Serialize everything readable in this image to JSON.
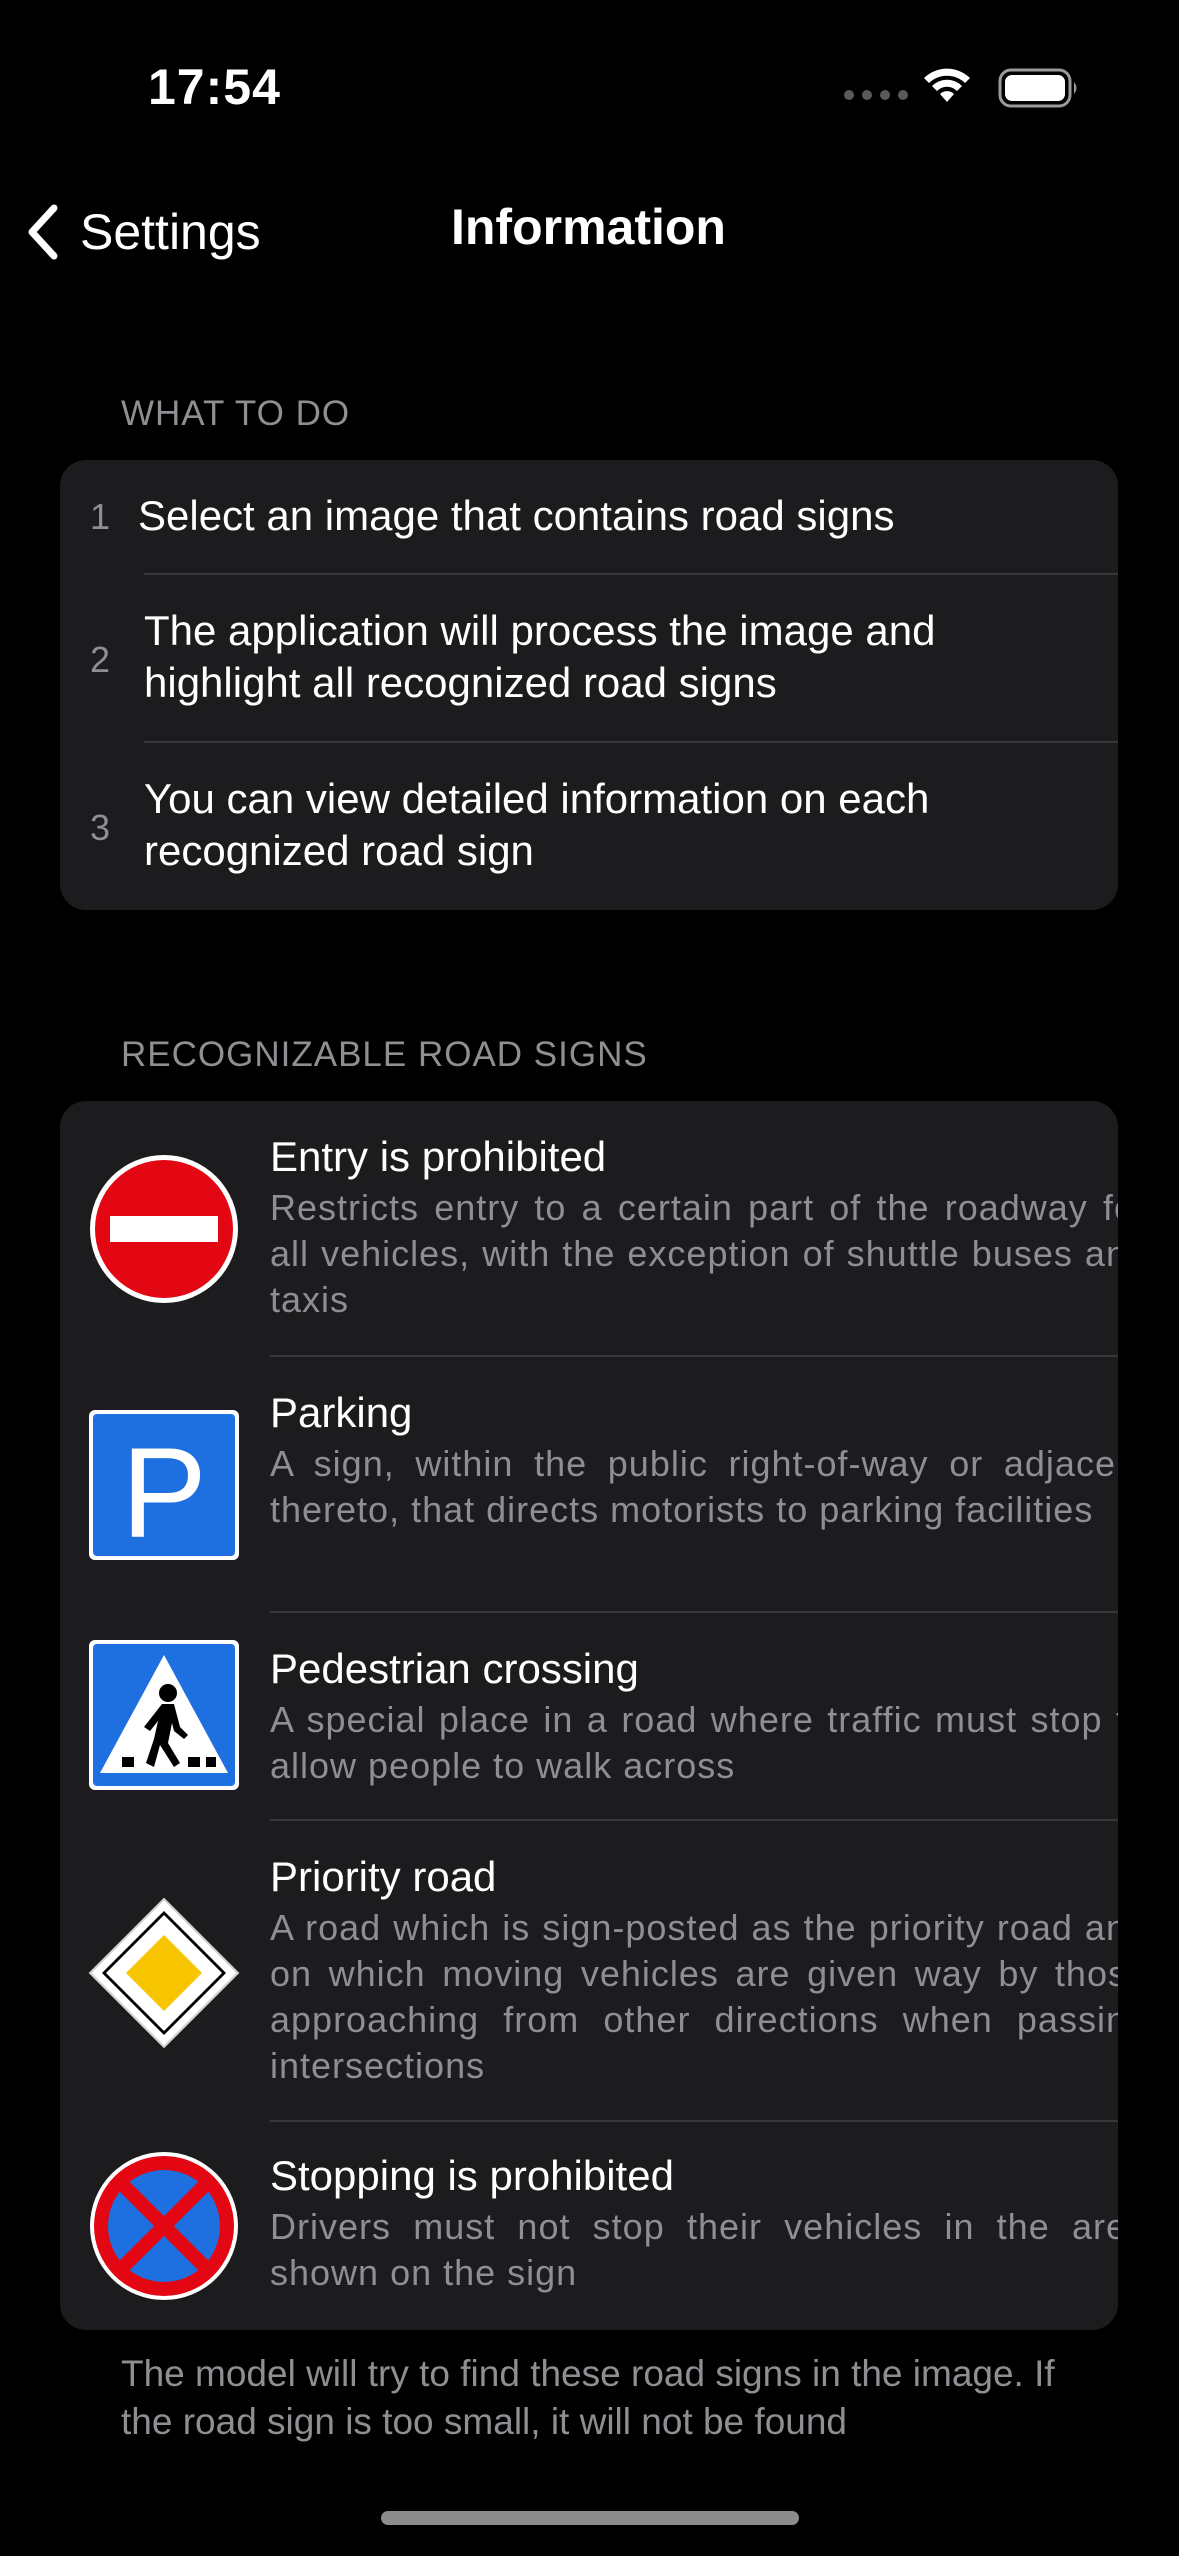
{
  "status_bar": {
    "time": "17:54"
  },
  "nav": {
    "back_label": "Settings",
    "title": "Information"
  },
  "what_to_do": {
    "header": "WHAT TO DO",
    "steps": [
      {
        "number": "1",
        "text": "Select an image that contains road signs"
      },
      {
        "number": "2",
        "text": "The application will process the image and highlight all recognized road signs"
      },
      {
        "number": "3",
        "text": "You can view detailed information on each recognized road sign"
      }
    ]
  },
  "signs": {
    "header": "RECOGNIZABLE ROAD SIGNS",
    "items": [
      {
        "title": "Entry is prohibited",
        "description": "Restricts entry to a certain part of the roadway for all vehicles, with the exception of shuttle buses and taxis",
        "icon": "no-entry-sign-icon"
      },
      {
        "title": "Parking",
        "description": "A sign, within the public right-of-way or adjacent thereto, that directs motorists to parking facilities",
        "icon": "parking-sign-icon"
      },
      {
        "title": "Pedestrian crossing",
        "description": "A special place in a road where traffic must stop to allow people to walk across",
        "icon": "pedestrian-crossing-sign-icon"
      },
      {
        "title": "Priority road",
        "description": "A road which is sign-posted as the priority road and on which moving vehicles are given way by those approaching from other directions when passing intersections",
        "icon": "priority-road-sign-icon"
      },
      {
        "title": "Stopping is prohibited",
        "description": "Drivers must not stop their vehicles in the area shown on the sign",
        "icon": "no-stopping-sign-icon"
      }
    ]
  },
  "footer": {
    "note": "The model will try to find these road signs in the image. If the road sign is too small, it will not be found"
  },
  "colors": {
    "background": "#000000",
    "card": "#1c1c1e",
    "secondary_text": "#8e8e93",
    "divider": "#38383a",
    "sign_red": "#e30613",
    "sign_blue": "#1e6fe0",
    "sign_yellow": "#f7c600"
  }
}
